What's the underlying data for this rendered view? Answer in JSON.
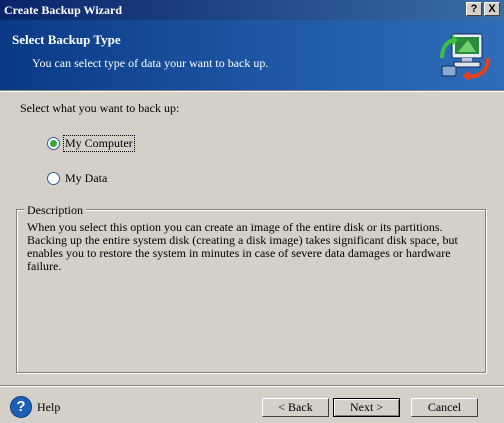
{
  "window": {
    "title": "Create Backup Wizard",
    "help_btn": "?",
    "close_btn": "X"
  },
  "header": {
    "title": "Select Backup Type",
    "subtitle": "You can select type of data your want to back up."
  },
  "main": {
    "prompt": "Select what you want to back up:",
    "options": [
      {
        "label": "My Computer",
        "selected": true
      },
      {
        "label": "My Data",
        "selected": false
      }
    ],
    "description_label": "Description",
    "description_text": "When you select this option you can create an image of the entire disk or its partitions. Backing up the entire system disk (creating a disk image) takes significant disk space, but enables you to restore the system in minutes in case of severe data damages or hardware failure."
  },
  "footer": {
    "help_label": "Help",
    "help_icon_glyph": "?",
    "back_label": "< Back",
    "next_label": "Next >",
    "cancel_label": "Cancel"
  },
  "colors": {
    "title_bar": "#0a246a",
    "header_bg": "#1c4e96",
    "dialog_bg": "#d4d0c8",
    "radio_selected": "#3aa53a"
  }
}
